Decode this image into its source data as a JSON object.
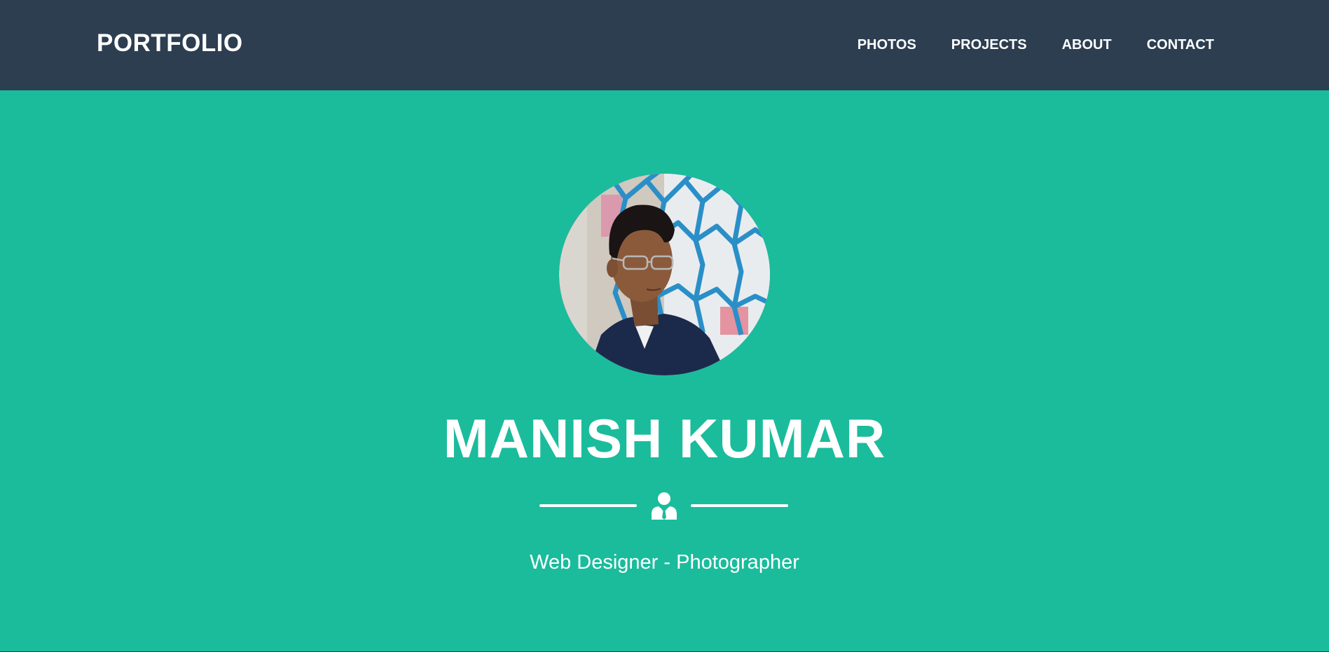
{
  "navbar": {
    "brand": "PORTFOLIO",
    "links": [
      {
        "label": "PHOTOS"
      },
      {
        "label": "PROJECTS"
      },
      {
        "label": "ABOUT"
      },
      {
        "label": "CONTACT"
      }
    ]
  },
  "masthead": {
    "name": "MANISH KUMAR",
    "divider_icon": "user-tie-icon",
    "tagline": "Web Designer - Photographer",
    "avatar_icon": "profile-photo"
  },
  "colors": {
    "navbar_bg": "#2c3e50",
    "masthead_bg": "#1abc9c",
    "text": "#ffffff"
  }
}
